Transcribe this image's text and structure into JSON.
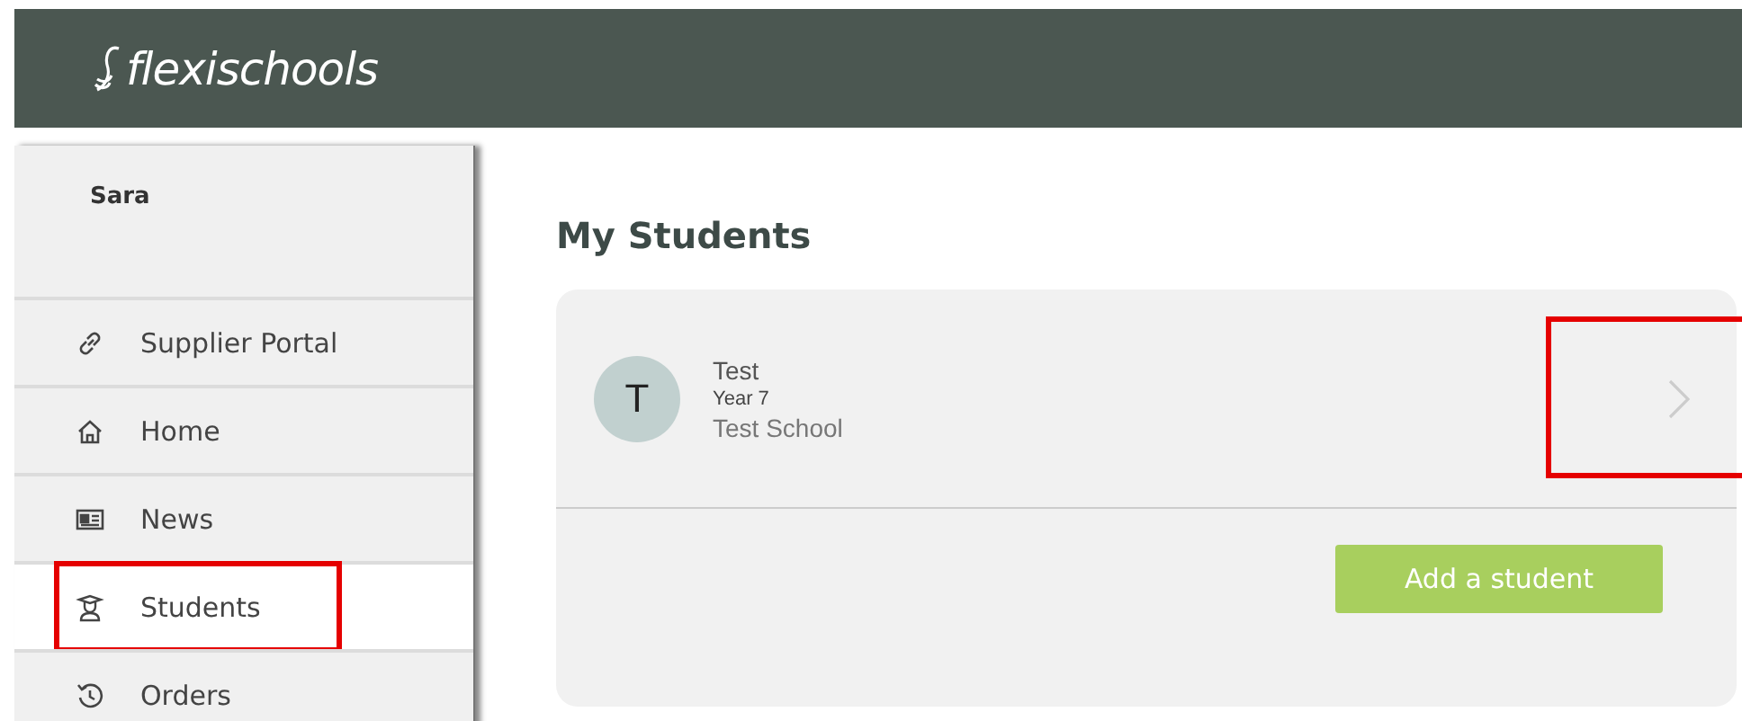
{
  "header": {
    "logo": "flexischools"
  },
  "sidebar": {
    "user": "Sara",
    "items": [
      {
        "kind": "link",
        "label": "Supplier Portal",
        "selected": false,
        "highlighted": false
      },
      {
        "kind": "home",
        "label": "Home",
        "selected": false,
        "highlighted": false
      },
      {
        "kind": "news",
        "label": "News",
        "selected": false,
        "highlighted": false
      },
      {
        "kind": "students",
        "label": "Students",
        "selected": true,
        "highlighted": true
      },
      {
        "kind": "orders",
        "label": "Orders",
        "selected": false,
        "highlighted": false
      }
    ]
  },
  "main": {
    "title": "My Students",
    "students": [
      {
        "initial": "T",
        "name": "Test",
        "year": "Year 7",
        "school": "Test School",
        "chevron_highlighted": true
      }
    ],
    "add_button": "Add a student"
  }
}
